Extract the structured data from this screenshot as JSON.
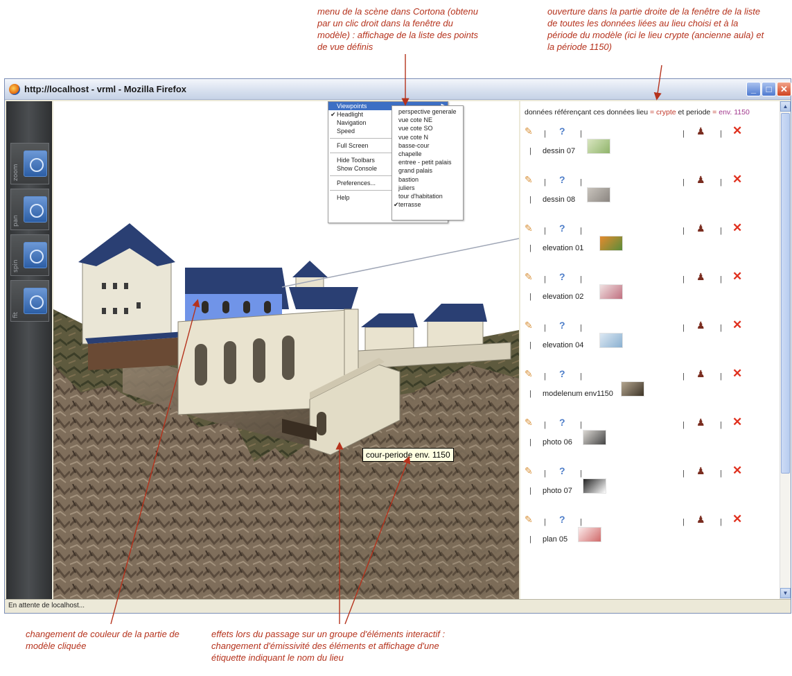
{
  "annotations": {
    "top_left": "menu de la scène dans Cortona (obtenu par un clic droit dans la fenêtre du modèle) : affichage de la liste des points de vue définis",
    "top_right": "ouverture dans la partie droite de la fenêtre de la liste de toutes les données liées au lieu choisi et à la période du modèle (ici le lieu crypte (ancienne aula) et la période 1150)",
    "bottom_left": "changement de couleur de la partie de modèle cliquée",
    "bottom_center": "effets lors du passage sur un groupe d'éléments interactif : changement d'émissivité des éléments et affichage d'une étiquette indiquant le nom du lieu"
  },
  "window": {
    "title": "http://localhost - vrml - Mozilla Firefox",
    "minimize_label": "_",
    "maximize_label": "□",
    "close_label": "✕",
    "status_text": "En attente de localhost..."
  },
  "cortona_nav": {
    "tools": [
      {
        "label": "zoom",
        "icon": "zoom-icon"
      },
      {
        "label": "pan",
        "icon": "pan-icon"
      },
      {
        "label": "spin",
        "icon": "spin-icon"
      },
      {
        "label": "fit",
        "icon": "fit-icon"
      }
    ]
  },
  "context_menu": {
    "items": [
      {
        "label": "Viewpoints",
        "submenu": true,
        "active": true
      },
      {
        "label": "Headlight",
        "checked": true
      },
      {
        "label": "Navigation",
        "submenu": true
      },
      {
        "label": "Speed",
        "submenu": true
      },
      {
        "label": "Full Screen",
        "submenu": true
      },
      {
        "label": "Hide Toolbars"
      },
      {
        "label": "Show Console"
      },
      {
        "label": "Preferences..."
      },
      {
        "label": "Help",
        "submenu": true
      }
    ],
    "viewpoints": [
      "perspective generale",
      "vue cote NE",
      "vue cote SO",
      "vue cote N",
      "basse-cour",
      "chapelle",
      "entree - petit palais",
      "grand palais",
      "bastion",
      "juliers",
      "tour d'habitation",
      "terrasse"
    ],
    "checked_viewpoint": "terrasse",
    "check_mark": "✔",
    "submenu_arrow": "▶"
  },
  "tooltip": "cour-periode env. 1150",
  "data_panel": {
    "header_prefix": "données référençant ces données lieu",
    "header_eq": "=",
    "lieu": "crypte",
    "header_and": "et periode",
    "periode": "env. 1150",
    "separator": "|",
    "icons": {
      "edit": "pencil-icon",
      "help": "help-icon",
      "user": "user-edit-icon",
      "delete": "delete-icon"
    },
    "records": [
      {
        "label": "dessin 07"
      },
      {
        "label": "dessin 08"
      },
      {
        "label": "elevation 01"
      },
      {
        "label": "elevation 02"
      },
      {
        "label": "elevation 04"
      },
      {
        "label": "modelenum env1150"
      },
      {
        "label": "photo 06"
      },
      {
        "label": "photo 07"
      },
      {
        "label": "plan 05"
      }
    ]
  },
  "colors": {
    "annotation": "#b5321c",
    "lieu_highlight": "#c2392b",
    "periode_highlight": "#a1378c",
    "menu_highlight": "#3d6fc4",
    "roof_blue": "#2a3f73",
    "clicked_part": "#6f8fe6"
  }
}
